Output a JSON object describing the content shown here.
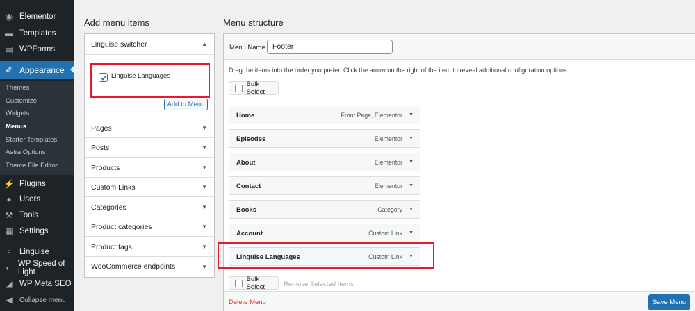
{
  "sidebar": {
    "items": [
      {
        "label": "Elementor",
        "icon": "elementor-icon"
      },
      {
        "label": "Templates",
        "icon": "folder-icon"
      },
      {
        "label": "WPForms",
        "icon": "form-icon"
      },
      {
        "label": "Appearance",
        "icon": "brush-icon"
      },
      {
        "label": "Plugins",
        "icon": "plugin-icon"
      },
      {
        "label": "Users",
        "icon": "user-icon"
      },
      {
        "label": "Tools",
        "icon": "wrench-icon"
      },
      {
        "label": "Settings",
        "icon": "settings-icon"
      },
      {
        "label": "Linguise",
        "icon": "linguise-icon"
      },
      {
        "label": "WP Speed of Light",
        "icon": "speed-icon"
      },
      {
        "label": "WP Meta SEO",
        "icon": "chart-icon"
      },
      {
        "label": "Collapse menu",
        "icon": "collapse-icon"
      }
    ],
    "submenu": [
      "Themes",
      "Customize",
      "Widgets",
      "Menus",
      "Starter Templates",
      "Astra Options",
      "Theme File Editor"
    ]
  },
  "left": {
    "heading": "Add menu items",
    "open_section": "Linguise switcher",
    "checkbox_label": "Linguise Languages",
    "add_button": "Add to Menu",
    "sections": [
      "Pages",
      "Posts",
      "Products",
      "Custom Links",
      "Categories",
      "Product categories",
      "Product tags",
      "WooCommerce endpoints"
    ]
  },
  "right": {
    "heading": "Menu structure",
    "menu_name_label": "Menu Name",
    "menu_name_value": "Footer",
    "instructions": "Drag the items into the order you prefer. Click the arrow on the right of the item to reveal additional configuration options.",
    "bulk_select": "Bulk Select",
    "remove_selected": "Remove Selected Items",
    "delete_menu": "Delete Menu",
    "save_menu": "Save Menu",
    "items": [
      {
        "title": "Home",
        "type": "Front Page, Elementor"
      },
      {
        "title": "Episodes",
        "type": "Elementor"
      },
      {
        "title": "About",
        "type": "Elementor"
      },
      {
        "title": "Contact",
        "type": "Elementor"
      },
      {
        "title": "Books",
        "type": "Category"
      },
      {
        "title": "Account",
        "type": "Custom Link"
      },
      {
        "title": "Linguise Languages",
        "type": "Custom Link"
      }
    ]
  },
  "colors": {
    "accent": "#2271b1",
    "sidebar_bg": "#1d2327",
    "highlight": "#e8192c",
    "delete": "#d63638"
  }
}
